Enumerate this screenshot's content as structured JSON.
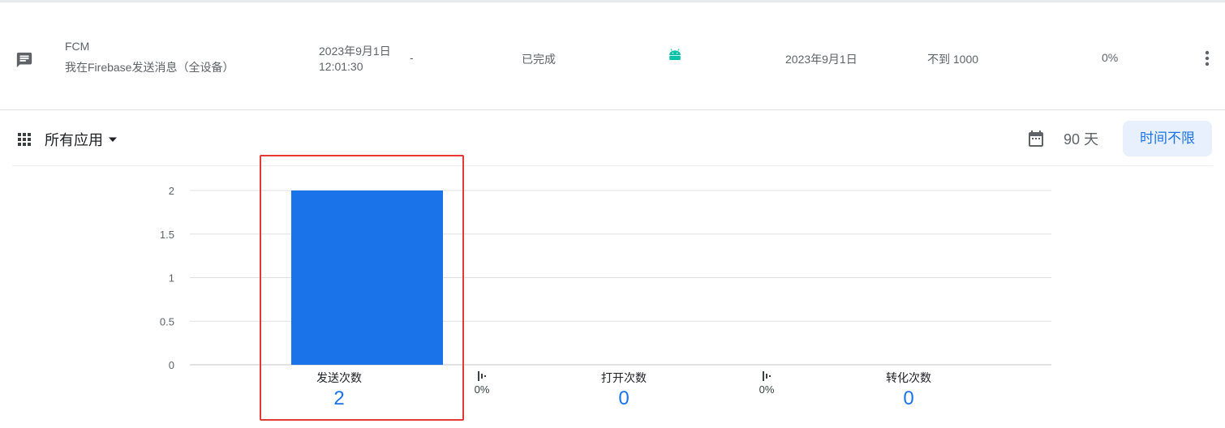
{
  "campaign_row": {
    "name": "FCM",
    "subtitle": "我在Firebase发送消息（全设备）",
    "sent_date": "2023年9月1日",
    "sent_time": "12:01:30",
    "end": "-",
    "status": "已完成",
    "platform_icon": "android-icon",
    "last_date": "2023年9月1日",
    "reach": "不到 1000",
    "rate": "0%"
  },
  "toolbar": {
    "apps_label": "所有应用",
    "range_90": "90 天",
    "range_all": "时间不限"
  },
  "colors": {
    "accent": "#1a73e8",
    "bar": "#1a73e8",
    "highlight": "#e53935",
    "android": "#00c2a8"
  },
  "chart_data": {
    "type": "bar",
    "categories": [
      "发送次数",
      "打开次数",
      "转化次数"
    ],
    "values": [
      2,
      0,
      0
    ],
    "y_ticks": [
      "0",
      "0.5",
      "1",
      "1.5",
      "2"
    ],
    "ylim": [
      0,
      2
    ],
    "grid": true
  },
  "metrics": [
    {
      "label": "发送次数",
      "value": "2"
    },
    {
      "label": "打开次数",
      "value": "0"
    },
    {
      "label": "转化次数",
      "value": "0"
    }
  ],
  "rates": [
    "0%",
    "0%"
  ]
}
